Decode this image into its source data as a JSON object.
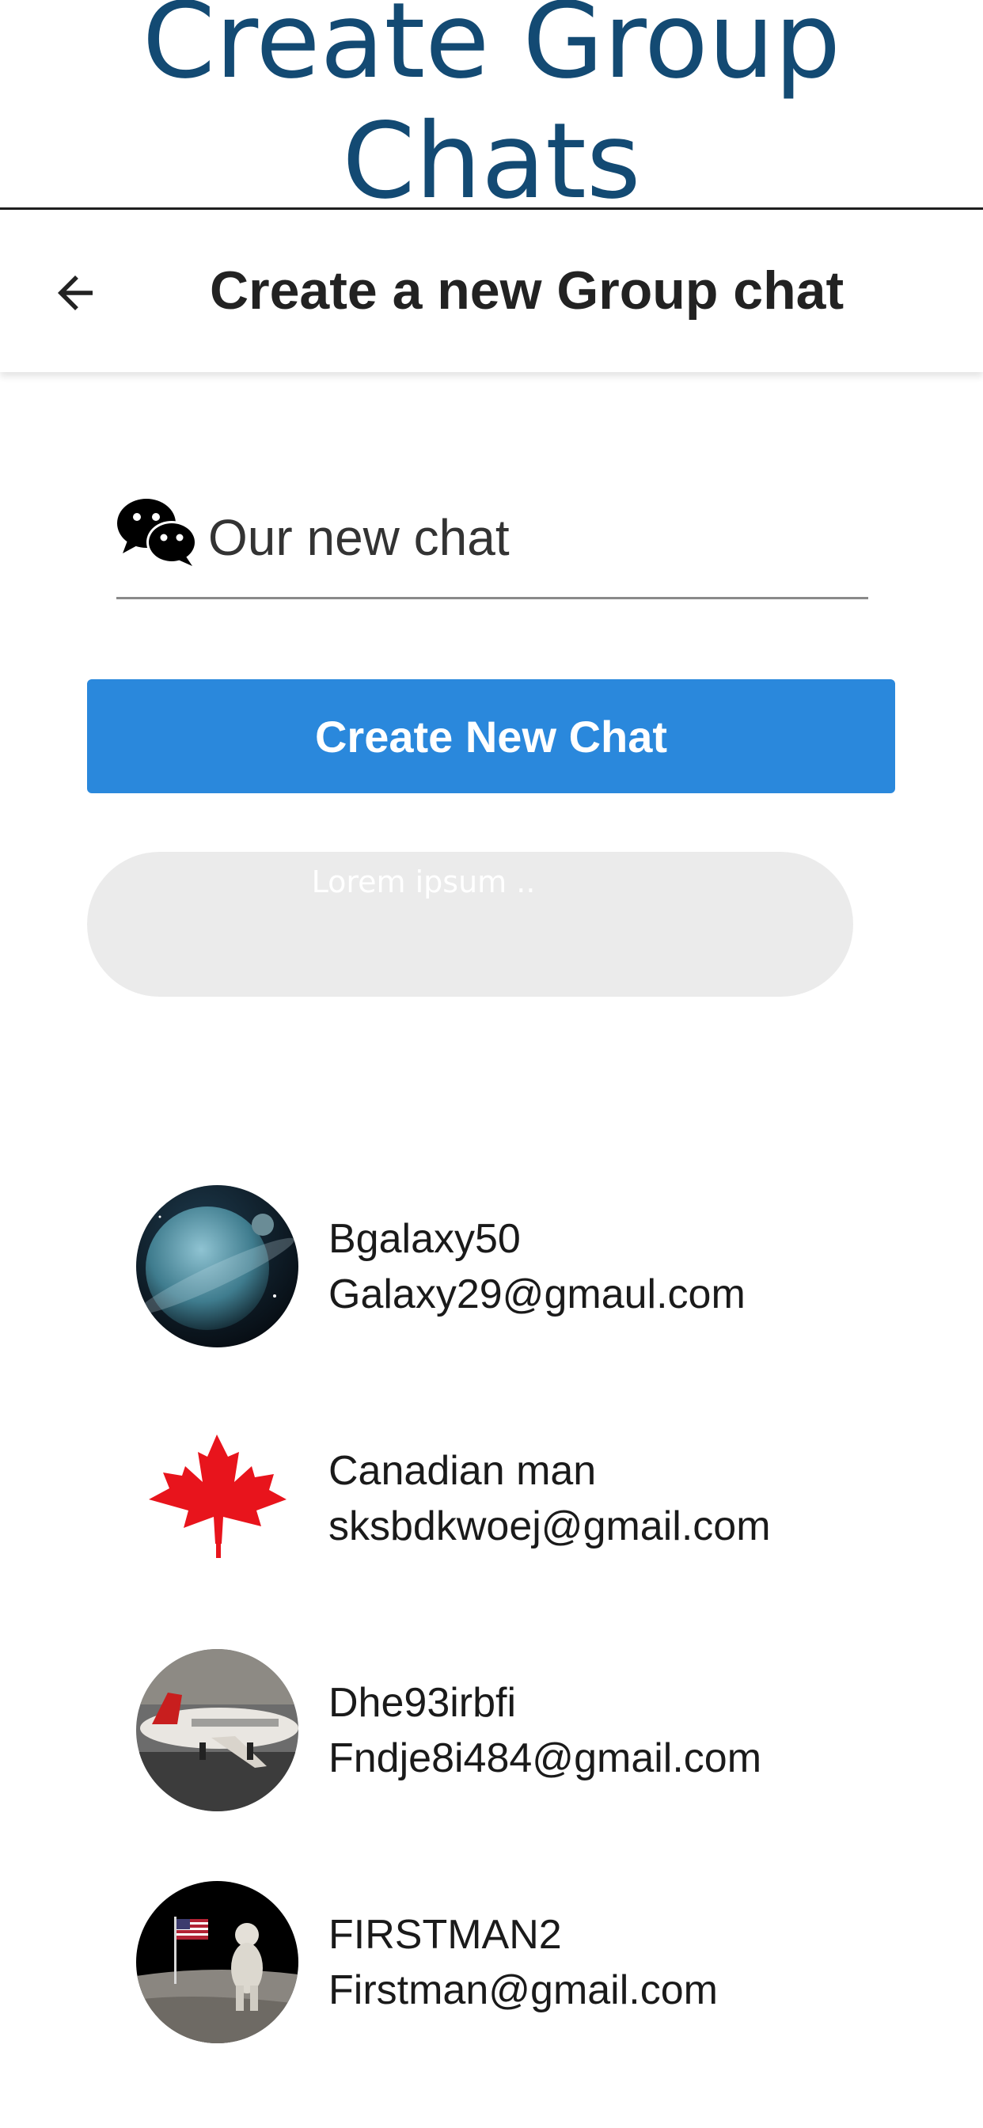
{
  "banner": {
    "title": "Create Group Chats"
  },
  "appbar": {
    "title": "Create a new Group chat",
    "back_icon": "arrow-left-icon"
  },
  "form": {
    "chat_icon": "wechat-bubbles-icon",
    "chat_name_value": "Our new chat",
    "create_button_label": "Create New Chat",
    "search_placeholder": "Lorem ipsum .."
  },
  "colors": {
    "banner_title": "#134a73",
    "primary_button": "#2a88dc",
    "search_bg": "#ebebeb"
  },
  "users": [
    {
      "name": "Bgalaxy50",
      "email": "Galaxy29@gmaul.com",
      "avatar": "planet-avatar"
    },
    {
      "name": "Canadian man",
      "email": "sksbdkwoej@gmail.com",
      "avatar": "maple-leaf-avatar"
    },
    {
      "name": "Dhe93irbfi",
      "email": "Fndje8i484@gmail.com",
      "avatar": "airplane-avatar"
    },
    {
      "name": "FIRSTMAN2",
      "email": "Firstman@gmail.com",
      "avatar": "astronaut-avatar"
    }
  ]
}
